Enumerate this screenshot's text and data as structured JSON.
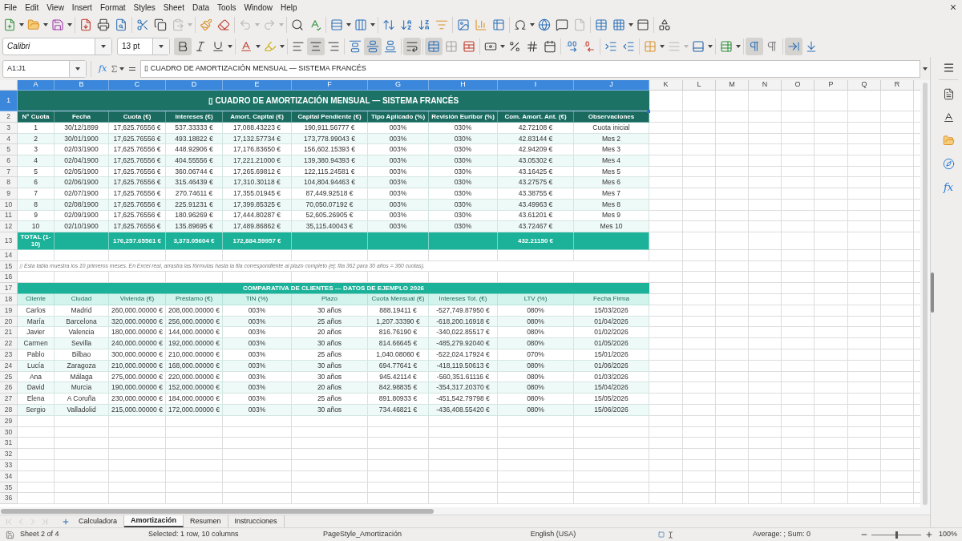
{
  "menu": [
    "File",
    "Edit",
    "View",
    "Insert",
    "Format",
    "Styles",
    "Sheet",
    "Data",
    "Tools",
    "Window",
    "Help"
  ],
  "standard_toolbar": {
    "paste_disabled": true,
    "undo_disabled": true,
    "redo_disabled": true
  },
  "format_toolbar": {
    "font_name": "Calibri",
    "font_size": "13 pt",
    "bold": true,
    "italic": false,
    "underline": false,
    "align_left": false,
    "align_center": true,
    "align_right": false,
    "valign_top": false,
    "valign_center": true,
    "valign_bottom": false,
    "wrap_text": true,
    "merge_center": true,
    "paragraph_ltr": true,
    "paragraph_rtl": false,
    "text_horizontal": true,
    "text_vertical": false
  },
  "formula_bar": {
    "name_box": "A1:J1",
    "function_wizard": "fx",
    "content": "▯ CUADRO DE AMORTIZACIÓN MENSUAL — SISTEMA FRANCÉS"
  },
  "column_headers": [
    {
      "label": "A",
      "selected": true
    },
    {
      "label": "B",
      "selected": true
    },
    {
      "label": "C",
      "selected": true
    },
    {
      "label": "D",
      "selected": true
    },
    {
      "label": "E",
      "selected": true
    },
    {
      "label": "F",
      "selected": true
    },
    {
      "label": "G",
      "selected": true
    },
    {
      "label": "H",
      "selected": true
    },
    {
      "label": "I",
      "selected": true
    },
    {
      "label": "J",
      "selected": true
    },
    {
      "label": "K",
      "selected": false
    },
    {
      "label": "L",
      "selected": false
    },
    {
      "label": "M",
      "selected": false
    },
    {
      "label": "N",
      "selected": false
    },
    {
      "label": "O",
      "selected": false
    },
    {
      "label": "P",
      "selected": false
    },
    {
      "label": "Q",
      "selected": false
    },
    {
      "label": "R",
      "selected": false
    }
  ],
  "row_headers": [
    {
      "label": "1",
      "selected": true
    },
    {
      "label": "2",
      "selected": false
    },
    {
      "label": "3",
      "selected": false
    },
    {
      "label": "4",
      "selected": false
    },
    {
      "label": "5",
      "selected": false
    },
    {
      "label": "6",
      "selected": false
    },
    {
      "label": "7",
      "selected": false
    },
    {
      "label": "8",
      "selected": false
    },
    {
      "label": "9",
      "selected": false
    },
    {
      "label": "10",
      "selected": false
    },
    {
      "label": "11",
      "selected": false
    },
    {
      "label": "12",
      "selected": false
    },
    {
      "label": "13",
      "selected": false
    },
    {
      "label": "14",
      "selected": false
    },
    {
      "label": "15",
      "selected": false
    },
    {
      "label": "16",
      "selected": false
    },
    {
      "label": "17",
      "selected": false
    },
    {
      "label": "18",
      "selected": false
    },
    {
      "label": "19",
      "selected": false
    },
    {
      "label": "20",
      "selected": false
    },
    {
      "label": "21",
      "selected": false
    },
    {
      "label": "22",
      "selected": false
    },
    {
      "label": "23",
      "selected": false
    },
    {
      "label": "24",
      "selected": false
    },
    {
      "label": "25",
      "selected": false
    },
    {
      "label": "26",
      "selected": false
    },
    {
      "label": "27",
      "selected": false
    },
    {
      "label": "28",
      "selected": false
    },
    {
      "label": "29",
      "selected": false
    },
    {
      "label": "30",
      "selected": false
    },
    {
      "label": "31",
      "selected": false
    },
    {
      "label": "32",
      "selected": false
    },
    {
      "label": "33",
      "selected": false
    },
    {
      "label": "34",
      "selected": false
    },
    {
      "label": "35",
      "selected": false
    },
    {
      "label": "36",
      "selected": false
    }
  ],
  "amortization": {
    "title": "▯ CUADRO DE AMORTIZACIÓN MENSUAL — SISTEMA FRANCÉS",
    "headers": [
      "N° Cuota",
      "Fecha",
      "Cuota (€)",
      "Intereses (€)",
      "Amort. Capital (€)",
      "Capital Pendiente (€)",
      "Tipo Aplicado (%)",
      "Revisión Euribor (%)",
      "Com. Amort. Ant. (€)",
      "Observaciones"
    ],
    "rows": [
      [
        "1",
        "30/12/1899",
        "17,625.76556 €",
        "537.33333 €",
        "17,088.43223 €",
        "190,911.56777 €",
        "003%",
        "030%",
        "42.72108 €",
        "Cuota inicial"
      ],
      [
        "2",
        "30/01/1900",
        "17,625.76556 €",
        "493.18822 €",
        "17,132.57734 €",
        "173,778.99043 €",
        "003%",
        "030%",
        "42.83144 €",
        "Mes 2"
      ],
      [
        "3",
        "02/03/1900",
        "17,625.76556 €",
        "448.92906 €",
        "17,176.83650 €",
        "156,602.15393 €",
        "003%",
        "030%",
        "42.94209 €",
        "Mes 3"
      ],
      [
        "4",
        "02/04/1900",
        "17,625.76556 €",
        "404.55556 €",
        "17,221.21000 €",
        "139,380.94393 €",
        "003%",
        "030%",
        "43.05302 €",
        "Mes 4"
      ],
      [
        "5",
        "02/05/1900",
        "17,625.76556 €",
        "360.06744 €",
        "17,265.69812 €",
        "122,115.24581 €",
        "003%",
        "030%",
        "43.16425 €",
        "Mes 5"
      ],
      [
        "6",
        "02/06/1900",
        "17,625.76556 €",
        "315.46439 €",
        "17,310.30118 €",
        "104,804.94463 €",
        "003%",
        "030%",
        "43.27575 €",
        "Mes 6"
      ],
      [
        "7",
        "02/07/1900",
        "17,625.76556 €",
        "270.74611 €",
        "17,355.01945 €",
        "87,449.92518 €",
        "003%",
        "030%",
        "43.38755 €",
        "Mes 7"
      ],
      [
        "8",
        "02/08/1900",
        "17,625.76556 €",
        "225.91231 €",
        "17,399.85325 €",
        "70,050.07192 €",
        "003%",
        "030%",
        "43.49963 €",
        "Mes 8"
      ],
      [
        "9",
        "02/09/1900",
        "17,625.76556 €",
        "180.96269 €",
        "17,444.80287 €",
        "52,605.26905 €",
        "003%",
        "030%",
        "43.61201 €",
        "Mes 9"
      ],
      [
        "10",
        "02/10/1900",
        "17,625.76556 €",
        "135.89695 €",
        "17,489.86862 €",
        "35,115.40043 €",
        "003%",
        "030%",
        "43.72467 €",
        "Mes 10"
      ]
    ],
    "total": {
      "label": "TOTAL (1-10)",
      "cuota": "176,257.65561 €",
      "intereses": "3,373.05604 €",
      "amort_capital": "172,884.59957 €",
      "com_amort_ant": "432.21150 €"
    }
  },
  "note": "▯ Esta tabla muestra los 10 primeros meses. En Excel real, arrastra las fórmulas hasta la fila correspondiente al plazo completo (ej: fila 362 para 30 años = 360 cuotas).",
  "comparison": {
    "title": "COMPARATIVA DE CLIENTES — DATOS DE EJEMPLO 2026",
    "headers": [
      "Cliente",
      "Ciudad",
      "Vivienda (€)",
      "Préstamo (€)",
      "TIN (%)",
      "Plazo",
      "Cuota Mensual (€)",
      "Intereses Tot. (€)",
      "LTV (%)",
      "Fecha Firma"
    ],
    "rows": [
      [
        "Carlos",
        "Madrid",
        "260,000.00000 €",
        "208,000.00000 €",
        "003%",
        "30 años",
        "888.19411 €",
        "-527,749.87950 €",
        "080%",
        "15/03/2026"
      ],
      [
        "María",
        "Barcelona",
        "320,000.00000 €",
        "256,000.00000 €",
        "003%",
        "25 años",
        "1,207.33390 €",
        "-618,200.16918 €",
        "080%",
        "01/04/2026"
      ],
      [
        "Javier",
        "Valencia",
        "180,000.00000 €",
        "144,000.00000 €",
        "003%",
        "20 años",
        "816.76190 €",
        "-340,022.85517 €",
        "080%",
        "01/02/2026"
      ],
      [
        "Carmen",
        "Sevilla",
        "240,000.00000 €",
        "192,000.00000 €",
        "003%",
        "30 años",
        "814.66645 €",
        "-485,279.92040 €",
        "080%",
        "01/05/2026"
      ],
      [
        "Pablo",
        "Bilbao",
        "300,000.00000 €",
        "210,000.00000 €",
        "003%",
        "25 años",
        "1,040.08060 €",
        "-522,024.17924 €",
        "070%",
        "15/01/2026"
      ],
      [
        "Lucía",
        "Zaragoza",
        "210,000.00000 €",
        "168,000.00000 €",
        "003%",
        "30 años",
        "694.77641 €",
        "-418,119.50613 €",
        "080%",
        "01/06/2026"
      ],
      [
        "Ana",
        "Málaga",
        "275,000.00000 €",
        "220,000.00000 €",
        "003%",
        "30 años",
        "945.42114 €",
        "-560,351.61116 €",
        "080%",
        "01/03/2026"
      ],
      [
        "David",
        "Murcia",
        "190,000.00000 €",
        "152,000.00000 €",
        "003%",
        "20 años",
        "842.98835 €",
        "-354,317.20370 €",
        "080%",
        "15/04/2026"
      ],
      [
        "Elena",
        "A Coruña",
        "230,000.00000 €",
        "184,000.00000 €",
        "003%",
        "25 años",
        "891.80933 €",
        "-451,542.79798 €",
        "080%",
        "15/05/2026"
      ],
      [
        "Sergio",
        "Valladolid",
        "215,000.00000 €",
        "172,000.00000 €",
        "003%",
        "30 años",
        "734.46821 €",
        "-436,408.55420 €",
        "080%",
        "15/06/2026"
      ]
    ]
  },
  "tab_navigation": {
    "disabled": true
  },
  "sheet_tabs": [
    {
      "label": "Calculadora",
      "selected": false
    },
    {
      "label": "Amortización",
      "selected": true
    },
    {
      "label": "Resumen",
      "selected": false
    },
    {
      "label": "Instrucciones",
      "selected": false
    }
  ],
  "status_bar": {
    "sheet": "Sheet 2 of 4",
    "selection": "Selected: 1 row, 10 columns",
    "page_style": "PageStyle_Amortización",
    "language": "English (USA)",
    "summary": "Average: ; Sum: 0",
    "zoom_slider": {
      "level": 0.5
    },
    "zoom": "100%"
  },
  "sidebar": {
    "functions": "fx"
  }
}
